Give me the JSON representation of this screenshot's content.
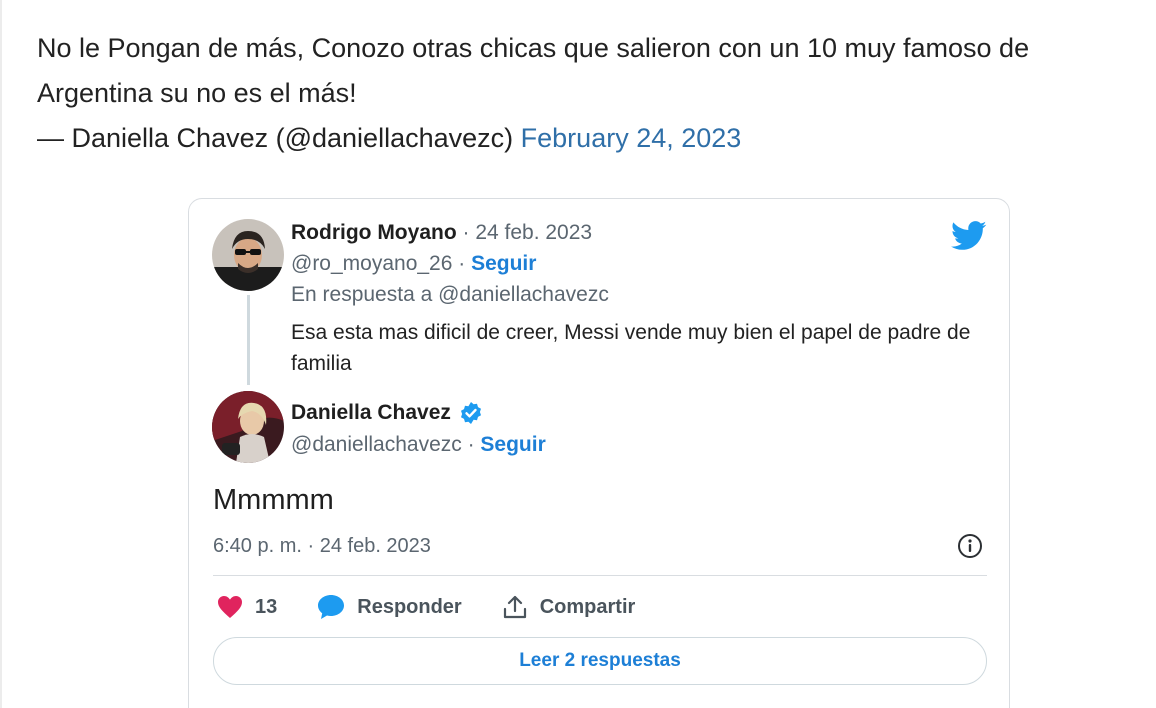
{
  "quote": {
    "text": "No le Pongan de más, Conozo otras chicas que salieron con un 10 muy famoso de Argentina su no es el más!",
    "attribution": "— Daniella Chavez (@daniellachavezc)",
    "date_link": "February 24, 2023"
  },
  "embed": {
    "reply_tweet": {
      "author_name": "Rodrigo Moyano",
      "date": " · 24 feb. 2023",
      "handle": "@ro_moyano_26 · ",
      "follow_label": "Seguir",
      "in_reply_to": "En respuesta a @daniellachavezc",
      "text": "Esa esta mas dificil de creer, Messi vende muy bien el papel de padre de familia"
    },
    "main_tweet": {
      "author_name": "Daniella Chavez",
      "handle": "@daniellachavezc · ",
      "follow_label": "Seguir",
      "text": "Mmmmm",
      "timestamp": "6:40 p. m. · 24 feb. 2023"
    },
    "actions": {
      "like_count": "13",
      "reply_label": "Responder",
      "share_label": "Compartir"
    },
    "read_replies_label": "Leer 2 respuestas",
    "colors": {
      "accent": "#1d7fd6",
      "like": "#e0245e",
      "link": "#2f6fa8"
    },
    "icons": [
      "twitter-bird-icon",
      "verified-badge-icon",
      "info-icon",
      "heart-icon",
      "reply-bubble-icon",
      "share-icon"
    ]
  }
}
